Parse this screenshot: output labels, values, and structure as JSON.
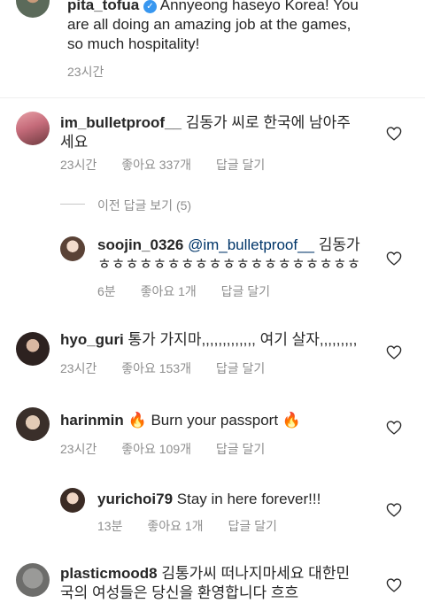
{
  "post": {
    "username": "pita_tofua",
    "caption": "Annyeong haseyo Korea! You are all doing an amazing job at the games, so much hospitality!",
    "time": "23시간"
  },
  "comments": [
    {
      "username": "im_bulletproof__",
      "text": "김동가 씨로 한국에 남아주세요",
      "time": "23시간",
      "likes": "좋아요 337개",
      "reply": "답글 달기"
    },
    {
      "view_replies": "이전 답글 보기 (5)"
    },
    {
      "username": "soojin_0326",
      "mention": "@im_bulletproof__",
      "text": "김동가 ㅎㅎㅎㅎㅎㅎㅎㅎㅎㅎㅎㅎㅎㅎㅎㅎㅎㅎㅎ",
      "time": "6분",
      "likes": "좋아요 1개",
      "reply": "답글 달기"
    },
    {
      "username": "hyo_guri",
      "text": "통가 가지마,,,,,,,,,,,,, 여기 살자,,,,,,,,,",
      "time": "23시간",
      "likes": "좋아요 153개",
      "reply": "답글 달기"
    },
    {
      "username": "harinmin",
      "fire": "🔥",
      "text": "Burn your passport",
      "time": "23시간",
      "likes": "좋아요 109개",
      "reply": "답글 달기"
    },
    {
      "username": "yurichoi79",
      "text": "Stay in here forever!!!",
      "time": "13분",
      "likes": "좋아요 1개",
      "reply": "답글 달기"
    },
    {
      "username": "plasticmood8",
      "text": "김통가씨 떠나지마세요 대한민국의 여성들은 당신을 환영합니다 흐흐"
    }
  ],
  "colors": {
    "text": "#262626",
    "meta": "#8e8e8e",
    "mention": "#003569",
    "verified": "#3897f0"
  }
}
